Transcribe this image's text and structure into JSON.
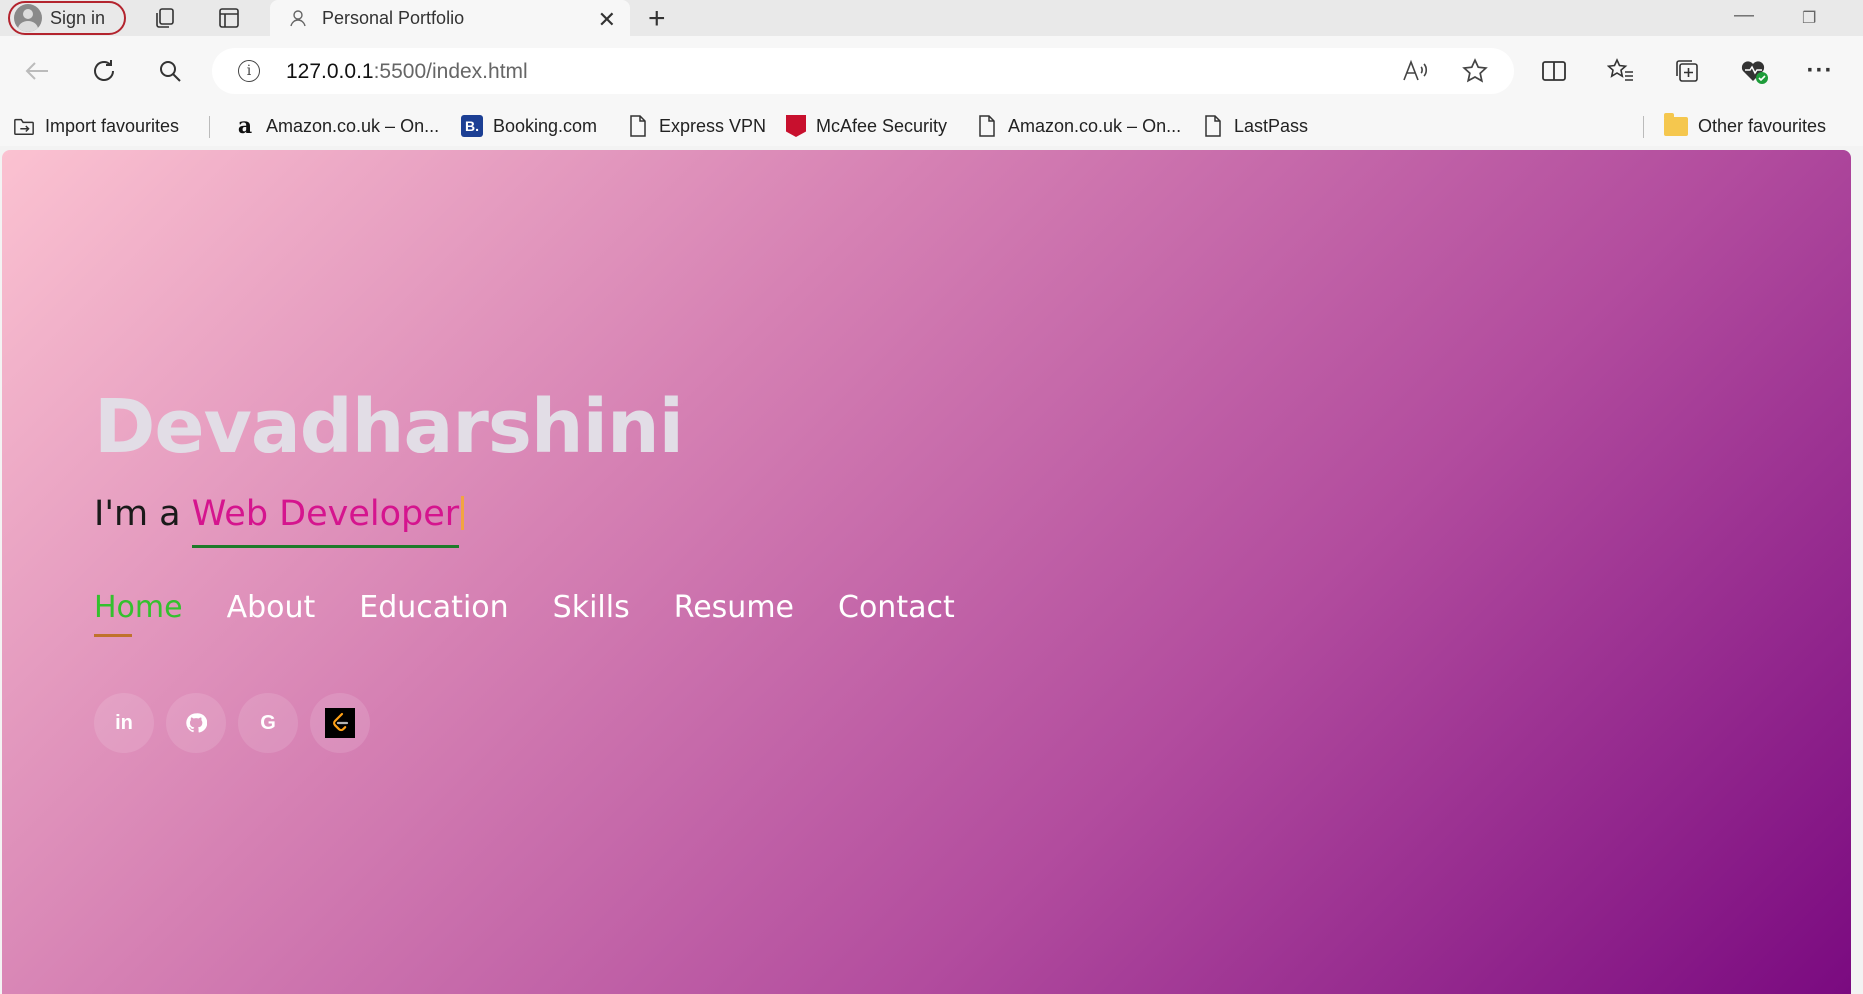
{
  "browser": {
    "signin_label": "Sign in",
    "tab_title": "Personal Portfolio",
    "url_host": "127.0.0.1",
    "url_rest": ":5500/index.html",
    "url_info_glyph": "i"
  },
  "favourites": {
    "import": "Import favourites",
    "items": [
      {
        "label": "Amazon.co.uk – On...",
        "icon": "amazon-icon"
      },
      {
        "label": "Booking.com",
        "icon": "booking-icon"
      },
      {
        "label": "Express VPN",
        "icon": "page-icon"
      },
      {
        "label": "McAfee Security",
        "icon": "mcafee-icon"
      },
      {
        "label": "Amazon.co.uk – On...",
        "icon": "page-icon"
      },
      {
        "label": "LastPass",
        "icon": "page-icon"
      }
    ],
    "other": "Other favourites",
    "booking_glyph": "B."
  },
  "hero": {
    "name": "Devadharshini",
    "intro": "I'm a ",
    "typed_word": "Web Developer"
  },
  "menu": {
    "items": [
      "Home",
      "About",
      "Education",
      "Skills",
      "Resume",
      "Contact"
    ],
    "active": "Home"
  },
  "socials": {
    "linkedin_glyph": "in",
    "google_glyph": "G"
  },
  "colors": {
    "accent_green": "#34c02e",
    "typed_pink": "#d5148e",
    "gradient_start": "#fbc2d1",
    "gradient_end": "#7a0a80"
  }
}
